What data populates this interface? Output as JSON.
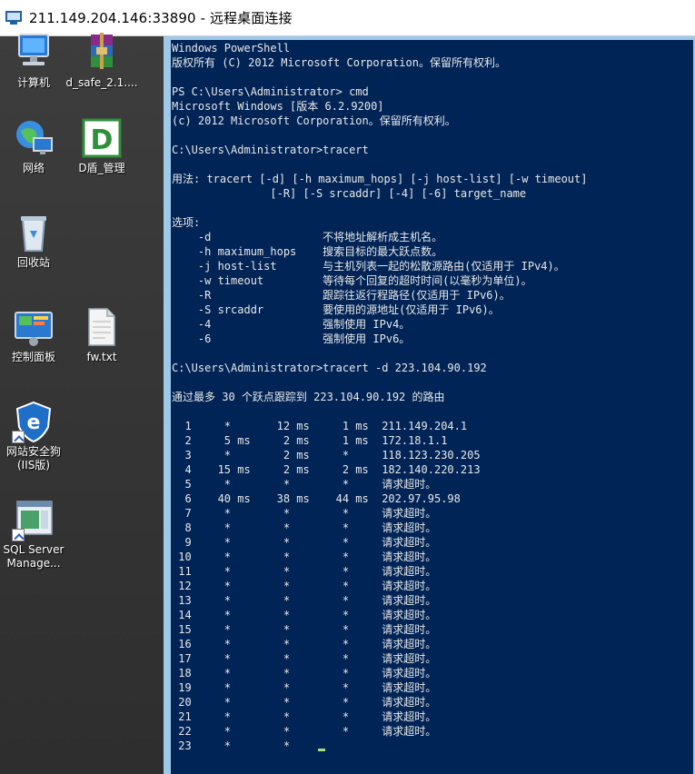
{
  "window": {
    "title": "211.149.204.146:33890 - 远程桌面连接"
  },
  "desktop": {
    "icons": [
      {
        "label": "计算机",
        "icon": "computer-icon"
      },
      {
        "label": "d_safe_2.1....",
        "icon": "winrar-archive-icon"
      },
      {
        "label": "网络",
        "icon": "network-icon"
      },
      {
        "label": "D盾_管理",
        "icon": "d-shield-icon"
      },
      {
        "label": "回收站",
        "icon": "recycle-bin-icon"
      },
      {
        "label": "控制面板",
        "icon": "control-panel-icon"
      },
      {
        "label": "fw.txt",
        "icon": "text-file-icon"
      },
      {
        "label": "网站安全狗\n(IIS版)",
        "icon": "safedog-icon"
      },
      {
        "label": "SQL Server\nManage...",
        "icon": "sql-server-icon"
      }
    ]
  },
  "console": {
    "lines": [
      "Windows PowerShell",
      "版权所有 (C) 2012 Microsoft Corporation。保留所有权利。",
      "",
      "PS C:\\Users\\Administrator> cmd",
      "Microsoft Windows [版本 6.2.9200]",
      "(c) 2012 Microsoft Corporation。保留所有权利。",
      "",
      "C:\\Users\\Administrator>tracert",
      "",
      "用法: tracert [-d] [-h maximum_hops] [-j host-list] [-w timeout]",
      "               [-R] [-S srcaddr] [-4] [-6] target_name",
      "",
      "选项:",
      "    -d                 不将地址解析成主机名。",
      "    -h maximum_hops    搜索目标的最大跃点数。",
      "    -j host-list       与主机列表一起的松散源路由(仅适用于 IPv4)。",
      "    -w timeout         等待每个回复的超时时间(以毫秒为单位)。",
      "    -R                 跟踪往返行程路径(仅适用于 IPv6)。",
      "    -S srcaddr         要使用的源地址(仅适用于 IPv6)。",
      "    -4                 强制使用 IPv4。",
      "    -6                 强制使用 IPv6。",
      "",
      "C:\\Users\\Administrator>tracert -d 223.104.90.192",
      "",
      "通过最多 30 个跃点跟踪到 223.104.90.192 的路由",
      "",
      "  1     *       12 ms     1 ms  211.149.204.1",
      "  2     5 ms     2 ms     1 ms  172.18.1.1",
      "  3     *        2 ms     *     118.123.230.205",
      "  4    15 ms     2 ms     2 ms  182.140.220.213",
      "  5     *        *        *     请求超时。",
      "  6    40 ms    38 ms    44 ms  202.97.95.98",
      "  7     *        *        *     请求超时。",
      "  8     *        *        *     请求超时。",
      "  9     *        *        *     请求超时。",
      " 10     *        *        *     请求超时。",
      " 11     *        *        *     请求超时。",
      " 12     *        *        *     请求超时。",
      " 13     *        *        *     请求超时。",
      " 14     *        *        *     请求超时。",
      " 15     *        *        *     请求超时。",
      " 16     *        *        *     请求超时。",
      " 17     *        *        *     请求超时。",
      " 18     *        *        *     请求超时。",
      " 19     *        *        *     请求超时。",
      " 20     *        *        *     请求超时。",
      " 21     *        *        *     请求超时。",
      " 22     *        *        *     请求超时。",
      " 23     *        *    "
    ]
  },
  "colors": {
    "console_bg": "#012456",
    "console_text": "#e8e8e8",
    "cursor": "#9fe07a",
    "window_border": "#9ec9e8"
  }
}
